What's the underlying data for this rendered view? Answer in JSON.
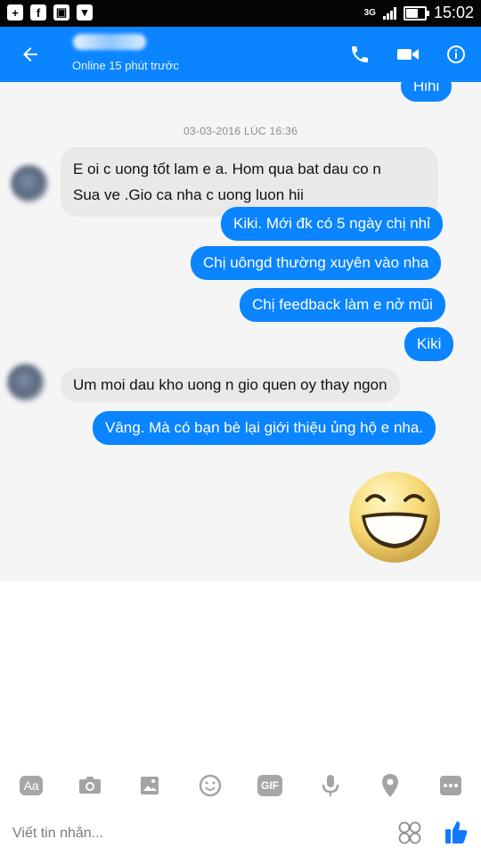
{
  "status": {
    "time": "15:02",
    "network": "3G"
  },
  "header": {
    "subtitle": "Online 15 phút trước",
    "icons": [
      "back-arrow-icon",
      "phone-icon",
      "video-camera-icon",
      "info-icon"
    ],
    "colors": {
      "brand": "#0b84ff",
      "outgoing": "#0a84ff",
      "incoming": "#e9e9e9"
    }
  },
  "chat": {
    "top_partial": "Hihi",
    "date": "03-03-2016 LÚC 16:36",
    "messages": [
      {
        "line1": "E oi c uong tốt lam e a. Hom qua bat dau co n",
        "line2": "Sua ve .Gio ca nha c uong luon hii"
      },
      {
        "text": "Kiki. Mới đk có 5 ngày chị nhỉ"
      },
      {
        "text": "Chị uôngd thường xuyên vào nha"
      },
      {
        "text": "Chị feedback làm e nở mũi"
      },
      {
        "text": "Kiki"
      },
      {
        "text": "Um moi dau kho uong n gio quen oy thay ngon"
      },
      {
        "text": "Vâng. Mà có bạn bè lại giới thiệu ủng hộ e nha."
      }
    ],
    "emoji": "grinning-face-sticker"
  },
  "toolbar": {
    "aa": "Aa",
    "gif": "GIF",
    "icons": [
      "camera-icon",
      "gallery-icon",
      "emoji-icon",
      "microphone-icon",
      "location-icon",
      "more-icon"
    ]
  },
  "composer": {
    "placeholder": "Viết tin nhắn...",
    "icons": [
      "sticker-icon",
      "like-icon"
    ]
  }
}
